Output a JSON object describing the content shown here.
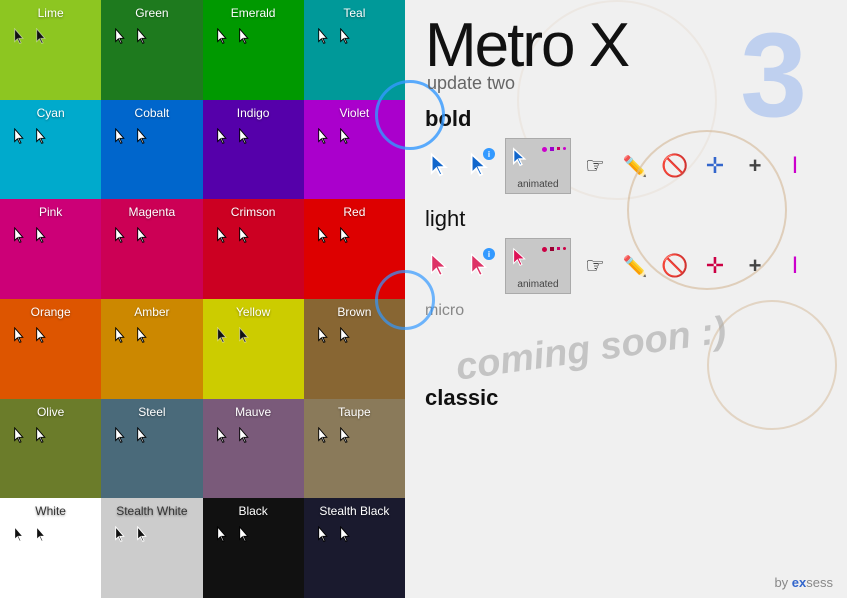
{
  "app": {
    "title": "Metro X",
    "version_number": "3",
    "subtitle": "update two"
  },
  "sections": {
    "bold_label": "bold",
    "light_label": "light",
    "micro_label": "micro",
    "coming_soon_text": "coming soon :)",
    "classic_label": "classic"
  },
  "animated_label": "animated",
  "by_line": "by exsess",
  "tiles": [
    {
      "id": "lime",
      "label": "Lime",
      "class": "tile-lime"
    },
    {
      "id": "green",
      "label": "Green",
      "class": "tile-green"
    },
    {
      "id": "emerald",
      "label": "Emerald",
      "class": "tile-emerald"
    },
    {
      "id": "teal",
      "label": "Teal",
      "class": "tile-teal"
    },
    {
      "id": "cyan",
      "label": "Cyan",
      "class": "tile-cyan"
    },
    {
      "id": "cobalt",
      "label": "Cobalt",
      "class": "tile-cobalt"
    },
    {
      "id": "indigo",
      "label": "Indigo",
      "class": "tile-indigo"
    },
    {
      "id": "violet",
      "label": "Violet",
      "class": "tile-violet"
    },
    {
      "id": "pink",
      "label": "Pink",
      "class": "tile-pink"
    },
    {
      "id": "magenta",
      "label": "Magenta",
      "class": "tile-magenta"
    },
    {
      "id": "crimson",
      "label": "Crimson",
      "class": "tile-crimson"
    },
    {
      "id": "red",
      "label": "Red",
      "class": "tile-red"
    },
    {
      "id": "orange",
      "label": "Orange",
      "class": "tile-orange"
    },
    {
      "id": "amber",
      "label": "Amber",
      "class": "tile-amber"
    },
    {
      "id": "yellow",
      "label": "Yellow",
      "class": "tile-yellow"
    },
    {
      "id": "brown",
      "label": "Brown",
      "class": "tile-brown"
    },
    {
      "id": "olive",
      "label": "Olive",
      "class": "tile-olive"
    },
    {
      "id": "steel",
      "label": "Steel",
      "class": "tile-steel"
    },
    {
      "id": "mauve",
      "label": "Mauve",
      "class": "tile-mauve"
    },
    {
      "id": "taupe",
      "label": "Taupe",
      "class": "tile-taupe"
    },
    {
      "id": "white",
      "label": "White",
      "class": "tile-white"
    },
    {
      "id": "stealth-white",
      "label": "Stealth White",
      "class": "tile-stealth-white"
    },
    {
      "id": "black",
      "label": "Black",
      "class": "tile-black"
    },
    {
      "id": "stealth-black",
      "label": "Stealth Black",
      "class": "tile-stealth-black"
    }
  ]
}
